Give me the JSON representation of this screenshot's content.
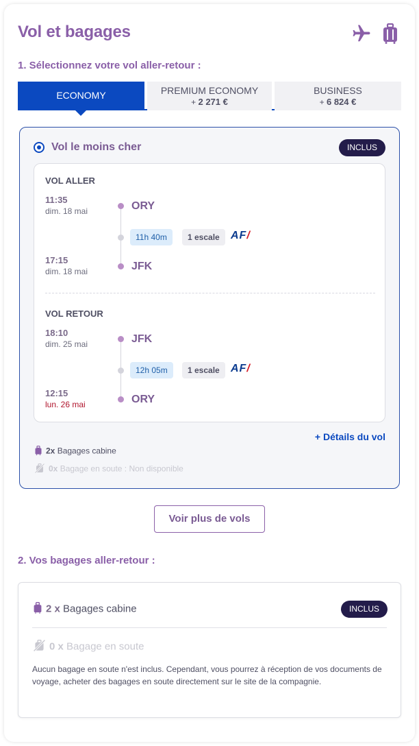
{
  "header": {
    "title": "Vol et bagages",
    "icons": [
      "airplane-icon",
      "luggage-icon"
    ],
    "accent_color": "#8a5fa8"
  },
  "section1": {
    "title": "1. Sélectionnez votre vol aller-retour :"
  },
  "tabs": [
    {
      "name": "ECONOMY",
      "price_prefix": "",
      "price": "",
      "active": true
    },
    {
      "name": "PREMIUM ECONOMY",
      "price_prefix": "+",
      "price": "2 271 €",
      "active": false
    },
    {
      "name": "BUSINESS",
      "price_prefix": "+",
      "price": "6 824 €",
      "active": false
    }
  ],
  "offer": {
    "title": "Vol le moins cher",
    "badge": "INCLUS",
    "outbound": {
      "label": "VOL ALLER",
      "dep_time": "11:35",
      "dep_date": "dim. 18 mai",
      "dep_airport": "ORY",
      "duration": "11h 40m",
      "stops": "1 escale",
      "airline": "AF",
      "arr_time": "17:15",
      "arr_date": "dim. 18 mai",
      "arr_airport": "JFK"
    },
    "inbound": {
      "label": "VOL RETOUR",
      "dep_time": "18:10",
      "dep_date": "dim. 25 mai",
      "dep_airport": "JFK",
      "duration": "12h 05m",
      "stops": "1 escale",
      "airline": "AF",
      "arr_time": "12:15",
      "arr_date": "lun. 26 mai",
      "arr_airport": "ORY"
    },
    "details_link": "+ Détails du vol",
    "cabin_bags": {
      "count": "2x",
      "label": "Bagages cabine"
    },
    "hold_bags": {
      "count": "0x",
      "label": "Bagage en soute : Non disponible"
    }
  },
  "more_button": "Voir plus de vols",
  "section2": {
    "title": "2. Vos bagages aller-retour :"
  },
  "bags": {
    "cabin": {
      "count": "2 x",
      "label": "Bagages cabine",
      "badge": "INCLUS"
    },
    "hold": {
      "count": "0 x",
      "label": "Bagage en soute"
    },
    "note": "Aucun bagage en soute n'est inclus. Cependant, vous pourrez à réception de vos documents de voyage, acheter des bagages en soute directement sur le site de la compagnie."
  }
}
